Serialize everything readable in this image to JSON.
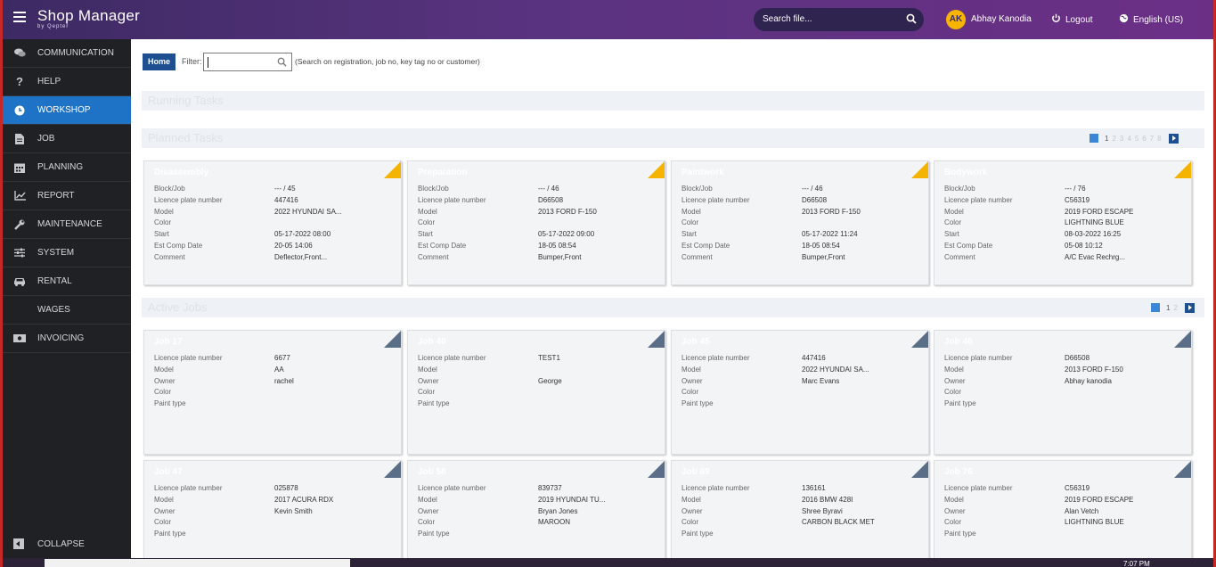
{
  "header": {
    "app_title": "Shop Manager",
    "app_subtitle": "by Qepter",
    "search_placeholder": "Search file...",
    "user_initials": "AK",
    "user_name": "Abhay Kanodia",
    "logout_label": "Logout",
    "language_label": "English (US)"
  },
  "sidebar": {
    "items": [
      {
        "label": "COMMUNICATION",
        "icon": "chat-icon"
      },
      {
        "label": "HELP",
        "icon": "question-icon"
      },
      {
        "label": "WORKSHOP",
        "icon": "clock-icon",
        "active": true
      },
      {
        "label": "JOB",
        "icon": "document-icon"
      },
      {
        "label": "PLANNING",
        "icon": "calendar-icon"
      },
      {
        "label": "REPORT",
        "icon": "chart-line-icon"
      },
      {
        "label": "MAINTENANCE",
        "icon": "wrench-icon"
      },
      {
        "label": "SYSTEM",
        "icon": "sliders-icon"
      },
      {
        "label": "RENTAL",
        "icon": "car-icon"
      },
      {
        "label": "WAGES",
        "icon": ""
      },
      {
        "label": "INVOICING",
        "icon": "money-icon"
      }
    ],
    "collapse_label": "COLLAPSE"
  },
  "toolbar": {
    "home_label": "Home",
    "filter_label": "Filter:",
    "filter_value": "",
    "filter_hint": "(Search on registration, job no, key tag no or customer)"
  },
  "sections": {
    "running_title": "Running Tasks",
    "planned_title": "Planned Tasks",
    "active_title": "Active Jobs"
  },
  "planned_pager": [
    "1",
    "2",
    "3",
    "4",
    "5",
    "6",
    "7",
    "8"
  ],
  "active_pager": [
    "1",
    "2"
  ],
  "planned_tasks": [
    {
      "title": "Disassembly",
      "rows": [
        [
          "Block/Job",
          "--- / 45"
        ],
        [
          "Licence plate number",
          "447416"
        ],
        [
          "Model",
          "2022 HYUNDAI SA..."
        ],
        [
          "Color",
          ""
        ],
        [
          "Start",
          "05-17-2022 08:00"
        ],
        [
          "Est Comp Date",
          "20-05 14:06"
        ],
        [
          "Comment",
          "Deflector,Front..."
        ]
      ]
    },
    {
      "title": "Preparation",
      "rows": [
        [
          "Block/Job",
          "--- / 46"
        ],
        [
          "Licence plate number",
          "D66508"
        ],
        [
          "Model",
          "2013 FORD F-150"
        ],
        [
          "Color",
          ""
        ],
        [
          "Start",
          "05-17-2022 09:00"
        ],
        [
          "Est Comp Date",
          "18-05 08:54"
        ],
        [
          "Comment",
          "Bumper,Front"
        ]
      ]
    },
    {
      "title": "Paintwork",
      "rows": [
        [
          "Block/Job",
          "--- / 46"
        ],
        [
          "Licence plate number",
          "D66508"
        ],
        [
          "Model",
          "2013 FORD F-150"
        ],
        [
          "Color",
          ""
        ],
        [
          "Start",
          "05-17-2022 11:24"
        ],
        [
          "Est Comp Date",
          "18-05 08:54"
        ],
        [
          "Comment",
          "Bumper,Front"
        ]
      ]
    },
    {
      "title": "Bodywork",
      "rows": [
        [
          "Block/Job",
          "--- / 76"
        ],
        [
          "Licence plate number",
          "C56319"
        ],
        [
          "Model",
          "2019 FORD ESCAPE"
        ],
        [
          "Color",
          "LIGHTNING BLUE"
        ],
        [
          "Start",
          "08-03-2022 16:25"
        ],
        [
          "Est Comp Date",
          "05-08 10:12"
        ],
        [
          "Comment",
          "A/C Evac Rechrg..."
        ]
      ]
    }
  ],
  "active_jobs": [
    {
      "title": "Job 17",
      "rows": [
        [
          "Licence plate number",
          "6677"
        ],
        [
          "Model",
          "AA"
        ],
        [
          "Owner",
          "rachel"
        ],
        [
          "Color",
          ""
        ],
        [
          "Paint type",
          ""
        ]
      ]
    },
    {
      "title": "Job 40",
      "rows": [
        [
          "Licence plate number",
          "TEST1"
        ],
        [
          "Model",
          ""
        ],
        [
          "Owner",
          "George"
        ],
        [
          "Color",
          ""
        ],
        [
          "Paint type",
          ""
        ]
      ]
    },
    {
      "title": "Job 45",
      "rows": [
        [
          "Licence plate number",
          "447416"
        ],
        [
          "Model",
          "2022 HYUNDAI SA..."
        ],
        [
          "Owner",
          "Marc Evans"
        ],
        [
          "Color",
          ""
        ],
        [
          "Paint type",
          ""
        ]
      ]
    },
    {
      "title": "Job 46",
      "rows": [
        [
          "Licence plate number",
          "D66508"
        ],
        [
          "Model",
          "2013 FORD F-150"
        ],
        [
          "Owner",
          "Abhay kanodia"
        ],
        [
          "Color",
          ""
        ],
        [
          "Paint type",
          ""
        ]
      ]
    },
    {
      "title": "Job 47",
      "rows": [
        [
          "Licence plate number",
          "025878"
        ],
        [
          "Model",
          "2017 ACURA RDX"
        ],
        [
          "Owner",
          "Kevin Smith"
        ],
        [
          "Color",
          ""
        ],
        [
          "Paint type",
          ""
        ]
      ]
    },
    {
      "title": "Job 58",
      "rows": [
        [
          "Licence plate number",
          "839737"
        ],
        [
          "Model",
          "2019 HYUNDAI TU..."
        ],
        [
          "Owner",
          "Bryan Jones"
        ],
        [
          "Color",
          "MAROON"
        ],
        [
          "Paint type",
          ""
        ]
      ]
    },
    {
      "title": "Job 69",
      "rows": [
        [
          "Licence plate number",
          "136161"
        ],
        [
          "Model",
          "2016 BMW 428I"
        ],
        [
          "Owner",
          "Shree Byravi"
        ],
        [
          "Color",
          "CARBON BLACK MET"
        ],
        [
          "Paint type",
          ""
        ]
      ]
    },
    {
      "title": "Job 76",
      "rows": [
        [
          "Licence plate number",
          "C56319"
        ],
        [
          "Model",
          "2019 FORD ESCAPE"
        ],
        [
          "Owner",
          "Alan Vetch"
        ],
        [
          "Color",
          "LIGHTNING BLUE"
        ],
        [
          "Paint type",
          ""
        ]
      ]
    }
  ],
  "taskbar": {
    "clock": "7:07 PM"
  },
  "colors": {
    "accent": "#1e73c7",
    "planned_fold": "#f5b400",
    "job_fold": "#5b6e87"
  }
}
